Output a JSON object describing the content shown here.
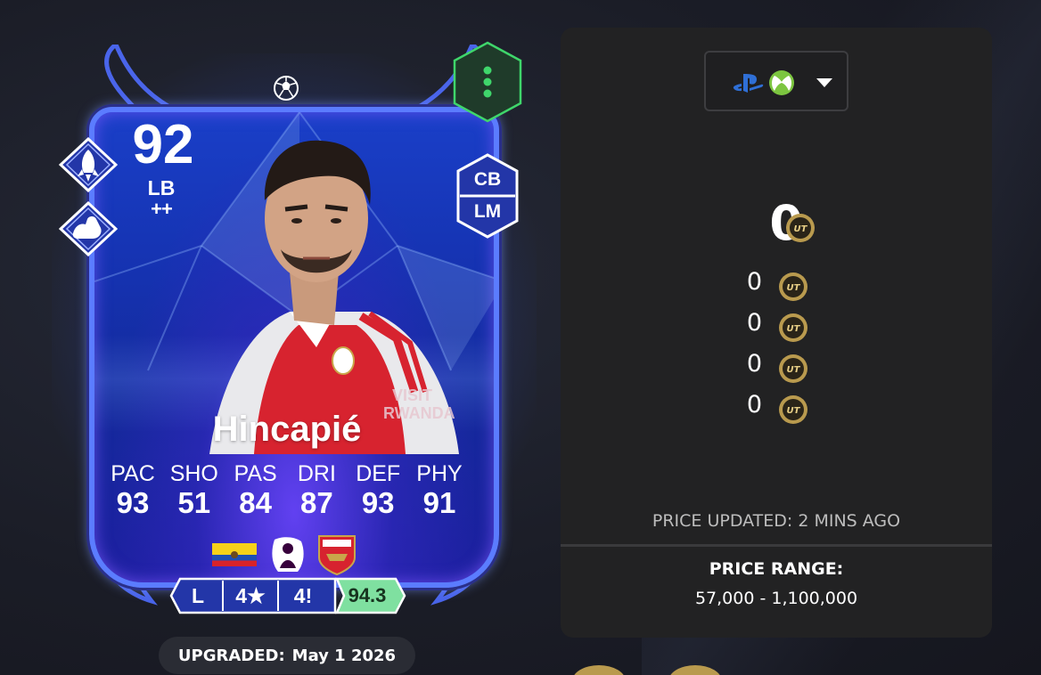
{
  "card": {
    "rating": "92",
    "position": "LB",
    "position_level": "++",
    "alt_positions": [
      "CB",
      "LM"
    ],
    "name": "Hincapié",
    "playstyles": [
      "rocket-icon",
      "flexed-arm-icon"
    ],
    "stats": [
      {
        "label": "PAC",
        "value": "93"
      },
      {
        "label": "SHO",
        "value": "51"
      },
      {
        "label": "PAS",
        "value": "84"
      },
      {
        "label": "DRI",
        "value": "87"
      },
      {
        "label": "DEF",
        "value": "93"
      },
      {
        "label": "PHY",
        "value": "91"
      }
    ],
    "badges": [
      "ecuador-flag-icon",
      "premier-league-icon",
      "arsenal-crest-icon"
    ],
    "info": {
      "foot": "L",
      "skill_moves": "4★",
      "weak_foot": "4",
      "weak_foot_icon": "exclamation-icon",
      "rating": "94.3"
    },
    "upgraded_label": "UPGRADED:",
    "upgraded_date": "May 1 2026",
    "accent_color": "#5b7cff",
    "menu_color": "#3fd66b"
  },
  "price": {
    "platform_icons": [
      "playstation-icon",
      "xbox-icon"
    ],
    "main": "0",
    "others": [
      "0",
      "0",
      "0",
      "0"
    ],
    "coin_icon": "ut-coin-icon",
    "updated": "PRICE UPDATED: 2 MINS AGO",
    "range_title": "PRICE RANGE:",
    "range_value": "57,000 - 1,100,000"
  }
}
